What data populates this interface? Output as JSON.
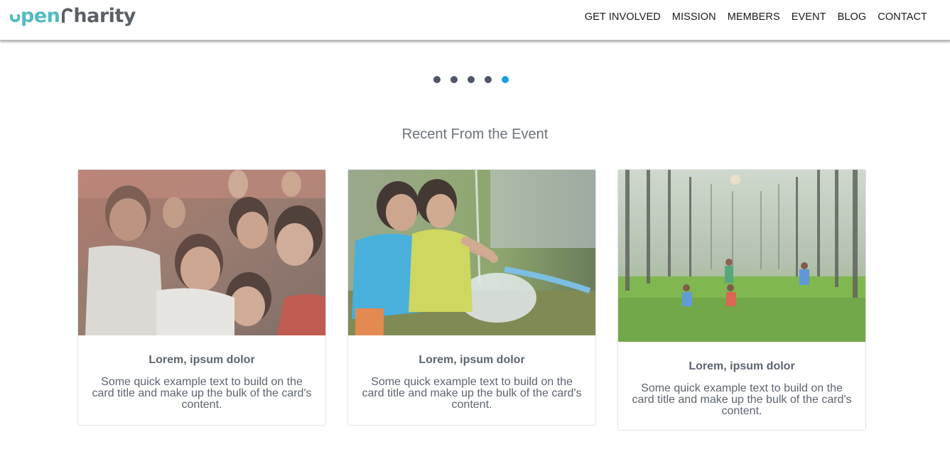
{
  "brand": {
    "logo_part1": "pen",
    "logo_part2": "harity",
    "primary_color": "#52bcc1",
    "secondary_color": "#5b6067"
  },
  "nav": {
    "items": [
      {
        "label": "GET INVOLVED"
      },
      {
        "label": "MISSION"
      },
      {
        "label": "MEMBERS"
      },
      {
        "label": "EVENT"
      },
      {
        "label": "BLOG"
      },
      {
        "label": "CONTACT"
      }
    ]
  },
  "carousel": {
    "dot_count": 5,
    "active_index": 4,
    "dot_color": "#4e5668",
    "active_color": "#1a9ee0"
  },
  "section": {
    "title": "Recent From the Event"
  },
  "cards": [
    {
      "title": "Lorem, ipsum dolor",
      "text": "Some quick example text to build on the card title and make up the bulk of the card's content.",
      "image": "children-smiling-photo"
    },
    {
      "title": "Lorem, ipsum dolor",
      "text": "Some quick example text to build on the card title and make up the bulk of the card's content.",
      "image": "children-playing-water-photo"
    },
    {
      "title": "Lorem, ipsum dolor",
      "text": "Some quick example text to build on the card title and make up the bulk of the card's content.",
      "image": "children-jumping-forest-photo"
    }
  ]
}
